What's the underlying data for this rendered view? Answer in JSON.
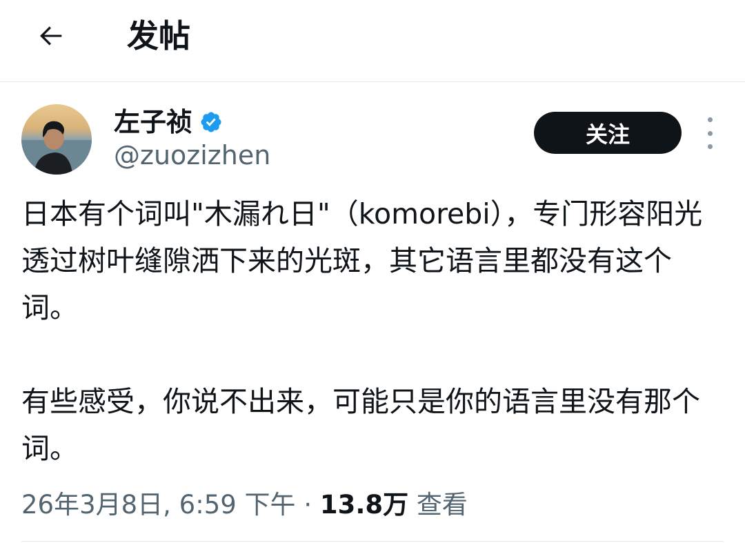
{
  "header": {
    "title": "发帖",
    "back_icon": "arrow-left-icon"
  },
  "author": {
    "display_name": "左子祯",
    "handle": "@zuozizhen",
    "verified": true,
    "verified_color": "#1d9bf0",
    "follow_label": "关注"
  },
  "tweet": {
    "paragraphs": [
      "日本有个词叫\"木漏れ日\"（komorebi），专门形容阳光透过树叶缝隙洒下来的光斑，其它语言里都没有这个词。",
      "有些感受，你说不出来，可能只是你的语言里没有那个词。"
    ],
    "timestamp": "26年3月8日, 6:59 下午",
    "separator": "·",
    "views_count": "13.8万",
    "views_label": "查看"
  },
  "colors": {
    "text_primary": "#0f1419",
    "text_secondary": "#536471",
    "button_bg": "#0f1419",
    "divider": "#e7e9ea"
  }
}
